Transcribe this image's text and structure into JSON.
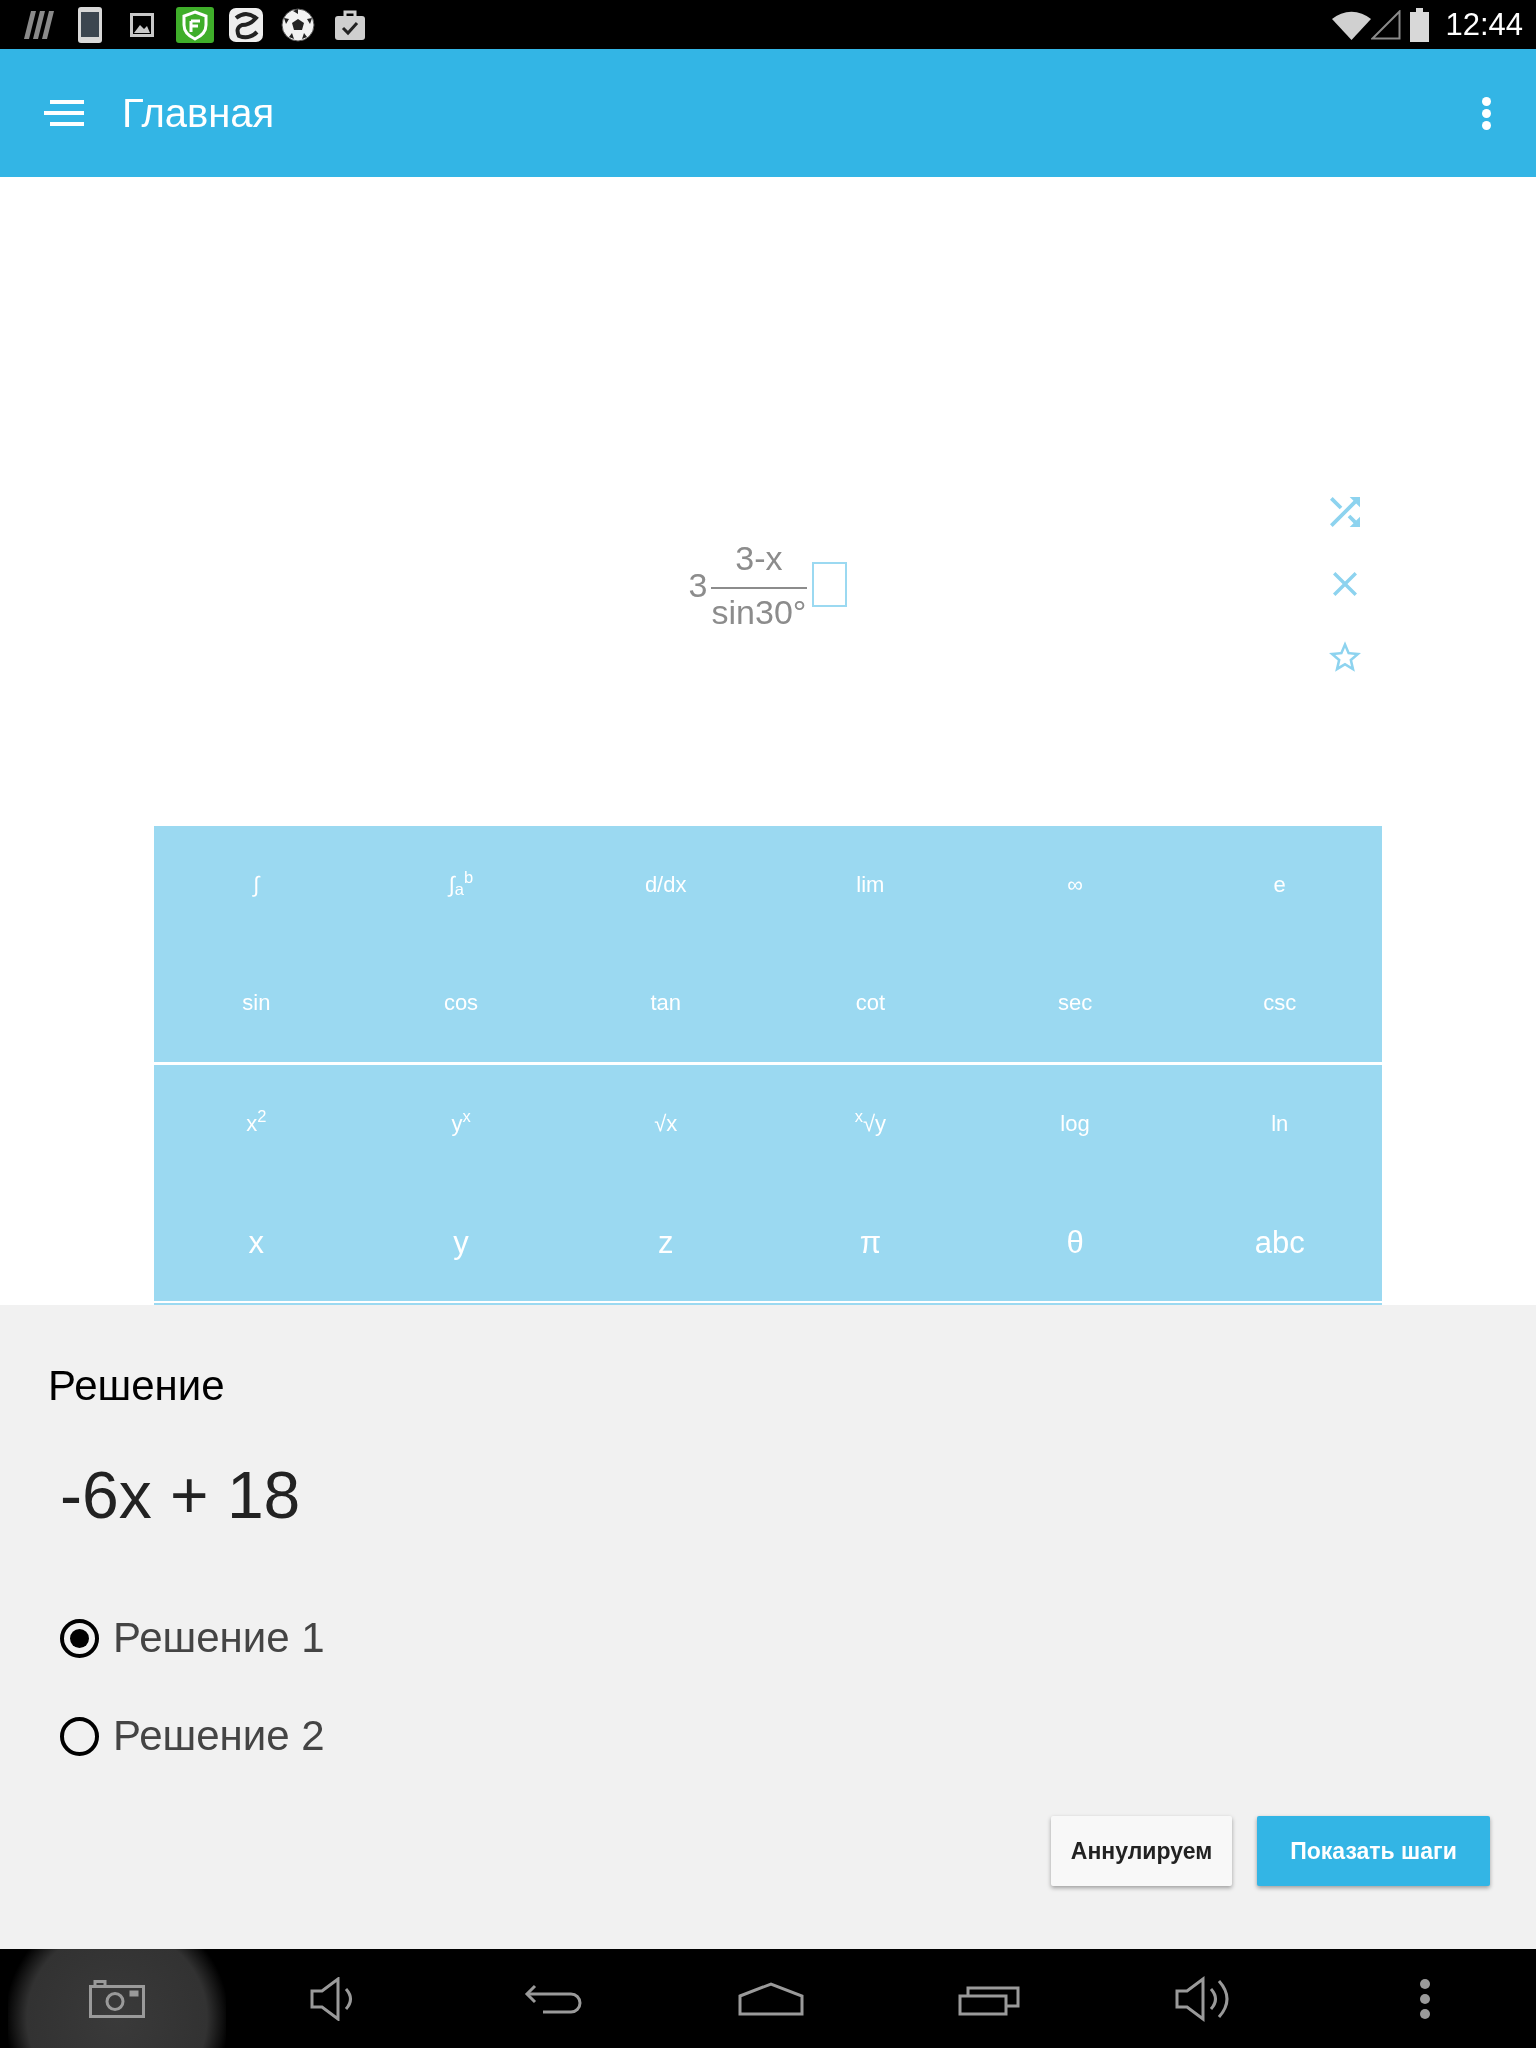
{
  "status_bar": {
    "time": "12:44"
  },
  "app_bar": {
    "title": "Главная"
  },
  "expression": {
    "whole": "3",
    "numerator": "3-x",
    "denominator": "sin30°"
  },
  "keypad": {
    "sections": [
      {
        "rows": [
          {
            "kind": "function",
            "keys": [
              "∫",
              "∫$_{a}$$^{b}$",
              "d/dx",
              "lim",
              "∞",
              "e"
            ]
          },
          {
            "kind": "function",
            "keys": [
              "sin",
              "cos",
              "tan",
              "cot",
              "sec",
              "csc"
            ]
          }
        ]
      },
      {
        "rows": [
          {
            "kind": "function",
            "keys": [
              "x$^{2}$",
              "y$^{x}$",
              "√x",
              "$^{x}$√y",
              "log",
              "ln"
            ]
          },
          {
            "kind": "variable",
            "keys": [
              "x",
              "y",
              "z",
              "π",
              "θ",
              "abc"
            ]
          }
        ]
      }
    ]
  },
  "solution": {
    "title": "Решение",
    "result": "-6x + 18",
    "options": [
      {
        "label": "Решение 1",
        "selected": true
      },
      {
        "label": "Решение 2",
        "selected": false
      }
    ],
    "buttons": [
      {
        "label": "Аннулируем",
        "kind": "secondary"
      },
      {
        "label": "Показать шаги",
        "kind": "primary"
      }
    ]
  },
  "nav_bar": {
    "buttons": [
      {
        "kind": "camera",
        "pressed": true
      },
      {
        "kind": "volume_down",
        "pressed": false
      },
      {
        "kind": "back",
        "pressed": false
      },
      {
        "kind": "home",
        "pressed": false
      },
      {
        "kind": "recents",
        "pressed": false
      },
      {
        "kind": "volume_up",
        "pressed": false
      },
      {
        "kind": "menu",
        "pressed": false
      }
    ]
  }
}
